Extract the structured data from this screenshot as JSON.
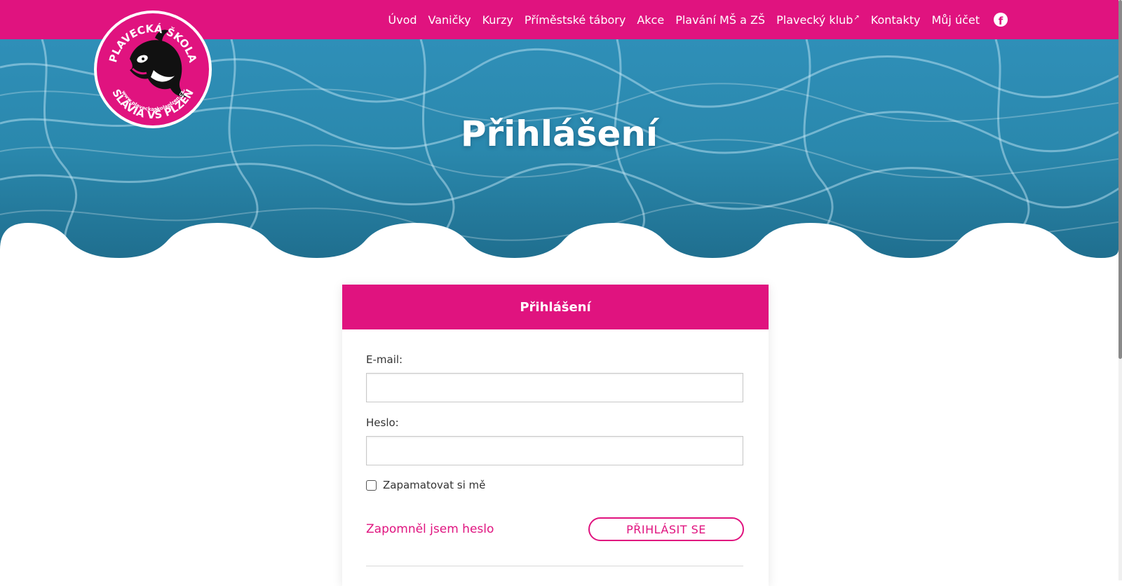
{
  "brand": {
    "accent_color": "#e0137f",
    "logo": {
      "text_top": "PLAVECKÁ ŠKOLA",
      "text_bottom": "SLÁVIA VŠ PLZEŇ",
      "url_text": "www.plaveckaskolaplzen.cz",
      "icon": "orca-icon"
    }
  },
  "nav": {
    "items": [
      {
        "label": "Úvod"
      },
      {
        "label": "Vaničky"
      },
      {
        "label": "Kurzy"
      },
      {
        "label": "Příměstské tábory"
      },
      {
        "label": "Akce"
      },
      {
        "label": "Plavání MŠ a ZŠ"
      },
      {
        "label": "Plavecký klub",
        "external": true
      },
      {
        "label": "Kontakty"
      },
      {
        "label": "Můj účet"
      }
    ],
    "social_icon": "facebook-icon"
  },
  "hero": {
    "title": "Přihlášení"
  },
  "login_form": {
    "header": "Přihlášení",
    "email_label": "E-mail:",
    "email_value": "",
    "password_label": "Heslo:",
    "password_value": "",
    "remember_label": "Zapamatovat si mě",
    "remember_checked": false,
    "forgot_link": "Zapomněl jsem heslo",
    "submit_label": "PŘIHLÁSIT SE"
  }
}
